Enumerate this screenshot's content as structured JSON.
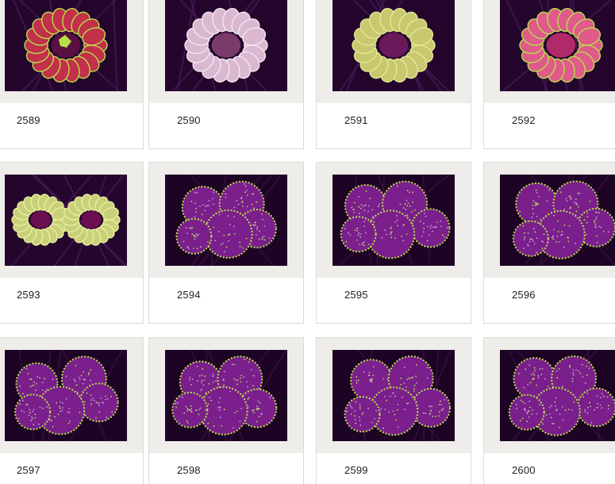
{
  "gallery": {
    "items": [
      {
        "number": "2589",
        "coral": "scoly-red-green"
      },
      {
        "number": "2590",
        "coral": "scoly-pink-white"
      },
      {
        "number": "2591",
        "coral": "scoly-yellow-ring"
      },
      {
        "number": "2592",
        "coral": "scoly-pink-green"
      },
      {
        "number": "2593",
        "coral": "scoly-split-green"
      },
      {
        "number": "2594",
        "coral": "mushroom-purple"
      },
      {
        "number": "2595",
        "coral": "mushroom-purple"
      },
      {
        "number": "2596",
        "coral": "mushroom-purple"
      },
      {
        "number": "2597",
        "coral": "mushroom-purple"
      },
      {
        "number": "2598",
        "coral": "mushroom-purple"
      },
      {
        "number": "2599",
        "coral": "mushroom-purple"
      },
      {
        "number": "2600",
        "coral": "mushroom-purple"
      }
    ]
  },
  "colors": {
    "frame_bg": "#efedea",
    "photo_bg": "#1a0420",
    "coral_purple": "#7a1f8c",
    "polyp_green": "#b8e04a",
    "scoly_red": "#c2304a",
    "scoly_pink": "#e8a6c8"
  }
}
